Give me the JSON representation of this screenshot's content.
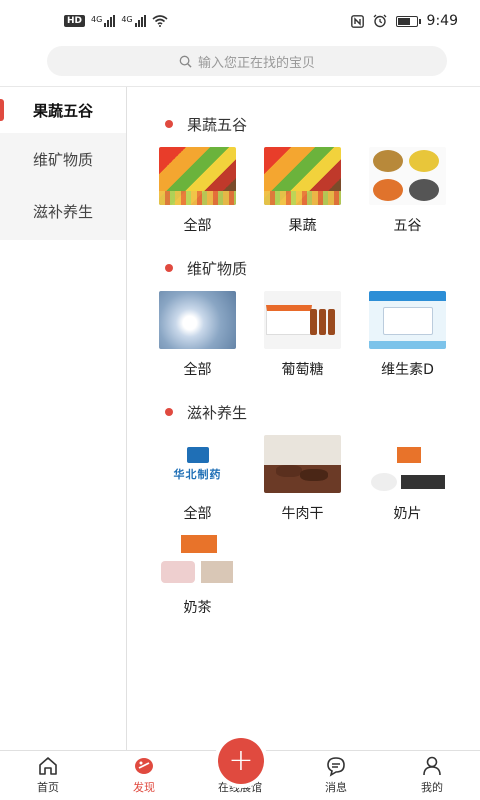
{
  "status": {
    "hd_badge": "HD",
    "net1": "4G",
    "net2": "4G",
    "time": "9:49",
    "battery_level": 0.6
  },
  "search": {
    "placeholder": "输入您正在找的宝贝"
  },
  "sidebar": {
    "items": [
      {
        "label": "果蔬五谷",
        "active": true
      },
      {
        "label": "维矿物质",
        "active": false
      },
      {
        "label": "滋补养生",
        "active": false
      }
    ]
  },
  "sections": [
    {
      "title": "果蔬五谷",
      "items": [
        {
          "label": "全部"
        },
        {
          "label": "果蔬"
        },
        {
          "label": "五谷"
        }
      ]
    },
    {
      "title": "维矿物质",
      "items": [
        {
          "label": "全部"
        },
        {
          "label": "葡萄糖"
        },
        {
          "label": "维生素D"
        }
      ]
    },
    {
      "title": "滋补养生",
      "items": [
        {
          "label": "全部",
          "logo_text": "华北制药"
        },
        {
          "label": "牛肉干"
        },
        {
          "label": "奶片"
        },
        {
          "label": "奶茶"
        }
      ]
    }
  ],
  "nav": {
    "home": "首页",
    "discover": "发现",
    "exhibit": "在线展馆",
    "messages": "消息",
    "mine": "我的"
  },
  "colors": {
    "accent": "#e04a3f"
  }
}
